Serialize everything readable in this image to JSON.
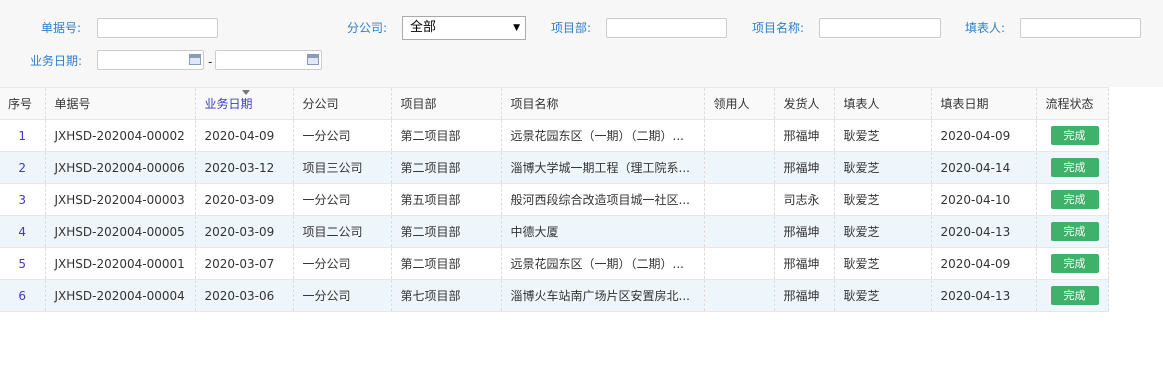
{
  "filters": {
    "doc_no_label": "单据号:",
    "branch_label": "分公司:",
    "branch_value": "全部",
    "dept_label": "项目部:",
    "project_label": "项目名称:",
    "filler_label": "填表人:",
    "date_label": "业务日期:",
    "date_sep": "-"
  },
  "table": {
    "headers": [
      "序号",
      "单据号",
      "业务日期",
      "分公司",
      "项目部",
      "项目名称",
      "领用人",
      "发货人",
      "填表人",
      "填表日期",
      "流程状态"
    ],
    "rows": [
      {
        "idx": "1",
        "doc": "JXHSD-202004-00002",
        "date": "2020-04-09",
        "branch": "一分公司",
        "dept": "第二项目部",
        "project": "远景花园东区（一期）（二期）...",
        "receiver": "",
        "shipper": "邢福坤",
        "filler": "耿爱芝",
        "fill_date": "2020-04-09",
        "status": "完成"
      },
      {
        "idx": "2",
        "doc": "JXHSD-202004-00006",
        "date": "2020-03-12",
        "branch": "项目三公司",
        "dept": "第二项目部",
        "project": "淄博大学城一期工程（理工院系...",
        "receiver": "",
        "shipper": "邢福坤",
        "filler": "耿爱芝",
        "fill_date": "2020-04-14",
        "status": "完成"
      },
      {
        "idx": "3",
        "doc": "JXHSD-202004-00003",
        "date": "2020-03-09",
        "branch": "一分公司",
        "dept": "第五项目部",
        "project": "般河西段综合改造项目城一社区...",
        "receiver": "",
        "shipper": "司志永",
        "filler": "耿爱芝",
        "fill_date": "2020-04-10",
        "status": "完成"
      },
      {
        "idx": "4",
        "doc": "JXHSD-202004-00005",
        "date": "2020-03-09",
        "branch": "项目二公司",
        "dept": "第二项目部",
        "project": "中德大厦",
        "receiver": "",
        "shipper": "邢福坤",
        "filler": "耿爱芝",
        "fill_date": "2020-04-13",
        "status": "完成"
      },
      {
        "idx": "5",
        "doc": "JXHSD-202004-00001",
        "date": "2020-03-07",
        "branch": "一分公司",
        "dept": "第二项目部",
        "project": "远景花园东区（一期）（二期）...",
        "receiver": "",
        "shipper": "邢福坤",
        "filler": "耿爱芝",
        "fill_date": "2020-04-09",
        "status": "完成"
      },
      {
        "idx": "6",
        "doc": "JXHSD-202004-00004",
        "date": "2020-03-06",
        "branch": "一分公司",
        "dept": "第七项目部",
        "project": "淄博火车站南广场片区安置房北...",
        "receiver": "",
        "shipper": "邢福坤",
        "filler": "耿爱芝",
        "fill_date": "2020-04-13",
        "status": "完成"
      }
    ]
  },
  "colors": {
    "accent": "#2f7ec8",
    "status_ok": "#3fb16a",
    "row_alt": "#eef6fc"
  }
}
